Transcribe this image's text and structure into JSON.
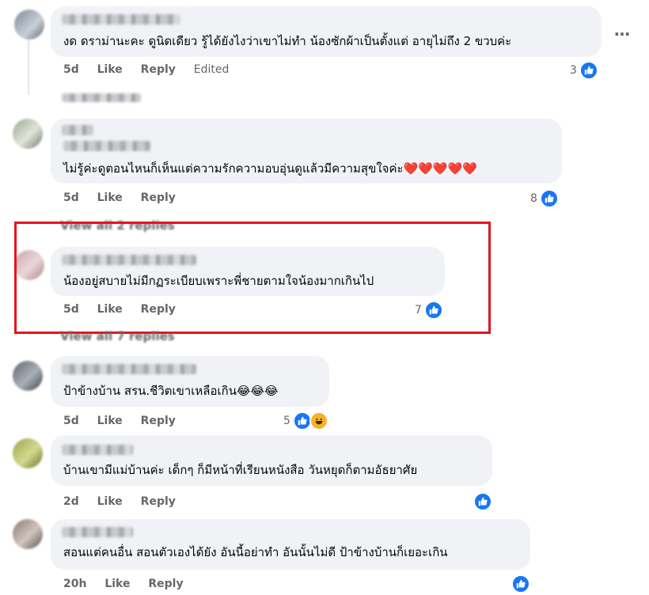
{
  "comments": [
    {
      "text": "งด ดราม่านะคะ ดูนิดเดียว รู้ได้ยังไงว่าเขาไม่ทำ น้องซักผ้าเป็นตั้งแต่ อายุไม่ถึง 2 ขวบค่ะ",
      "time": "5d",
      "like": "Like",
      "reply": "Reply",
      "edited": "Edited",
      "reactions": "3"
    },
    {
      "text": "ไม่รู้ค่ะดูตอนไหนก็เห็นแต่ความรักความอบอุ่นดูแล้วมีความสุขใจค่ะ❤️❤️❤️❤️❤️",
      "time": "5d",
      "like": "Like",
      "reply": "Reply",
      "reactions": "8",
      "view_replies": "View all 2 replies"
    },
    {
      "text": "น้องอยู่สบายไม่มีกฏระเบียบเพราะพี่ชายตามใจน้องมากเกินไป",
      "time": "5d",
      "like": "Like",
      "reply": "Reply",
      "reactions": "7",
      "view_replies": "View all 7 replies"
    },
    {
      "text": "ป้าข้างบ้าน สรน.ชีวิตเขาเหลือเกิน😂😂😂",
      "time": "5d",
      "like": "Like",
      "reply": "Reply",
      "reactions": "5"
    },
    {
      "text": "บ้านเขามีแม่บ้านค่ะ เด็กๆ ก็มีหน้าที่เรียนหนังสือ วันหยุดก็ตามอัธยาศัย",
      "time": "2d",
      "like": "Like",
      "reply": "Reply"
    },
    {
      "text": "สอนแต่คนอื่น สอนตัวเองได้ยัง อันนี้อย่าทำ อันนั้นไม่ดี ป้าข้างบ้านก็เยอะเกิน",
      "time": "20h",
      "like": "Like",
      "reply": "Reply"
    }
  ],
  "more_menu": "…",
  "colors": {
    "like_blue": "#1877f2",
    "highlight_red": "#e5151b",
    "bubble": "#f0f2f5"
  }
}
